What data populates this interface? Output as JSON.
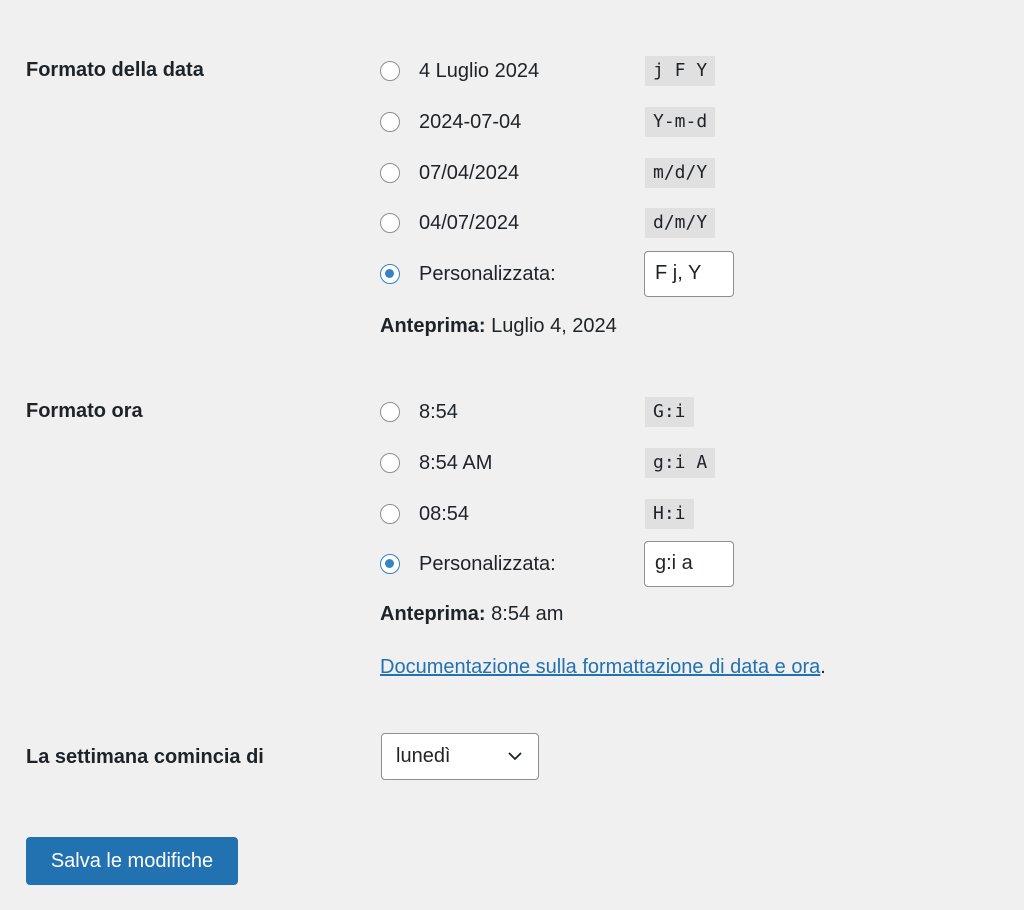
{
  "date_format": {
    "label": "Formato della data",
    "options": [
      {
        "display": "4 Luglio 2024",
        "code": "j F Y",
        "checked": false
      },
      {
        "display": "2024-07-04",
        "code": "Y-m-d",
        "checked": false
      },
      {
        "display": "07/04/2024",
        "code": "m/d/Y",
        "checked": false
      },
      {
        "display": "04/07/2024",
        "code": "d/m/Y",
        "checked": false
      }
    ],
    "custom_label": "Personalizzata:",
    "custom_value": "F j, Y",
    "custom_checked": true,
    "preview_label": "Anteprima:",
    "preview_value": " Luglio 4, 2024"
  },
  "time_format": {
    "label": "Formato ora",
    "options": [
      {
        "display": "8:54",
        "code": "G:i",
        "checked": false
      },
      {
        "display": "8:54 AM",
        "code": "g:i A",
        "checked": false
      },
      {
        "display": "08:54",
        "code": "H:i",
        "checked": false
      }
    ],
    "custom_label": "Personalizzata:",
    "custom_value": "g:i a",
    "custom_checked": true,
    "preview_label": "Anteprima:",
    "preview_value": " 8:54 am"
  },
  "documentation": {
    "link_text": "Documentazione sulla formattazione di data e ora",
    "trailing": "."
  },
  "week_start": {
    "label": "La settimana comincia di",
    "selected": "lunedì"
  },
  "save_button": {
    "label": "Salva le modifiche"
  },
  "colors": {
    "background": "#f0f0f1",
    "accent": "#2271b1",
    "radio_checked": "#3582c4",
    "text": "#1d2327",
    "code_bg": "#e0e0e1"
  }
}
